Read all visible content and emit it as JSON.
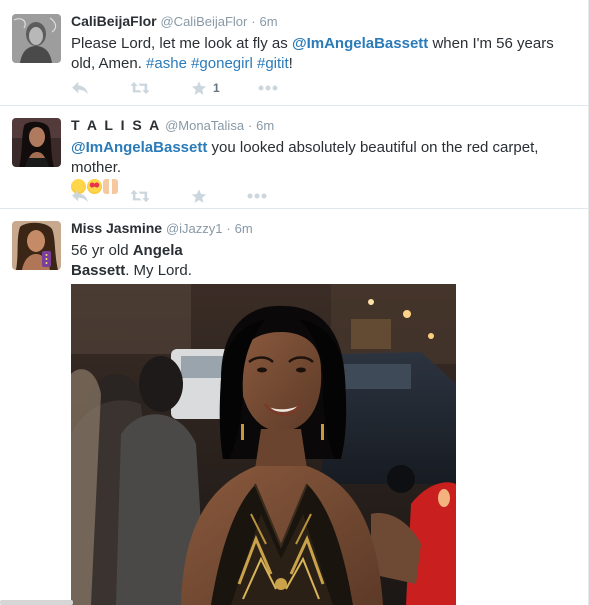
{
  "tweets": [
    {
      "fullname": "CaliBeijaFlor",
      "username": "@CaliBeijaFlor",
      "separator": "·",
      "time": "6m",
      "text_parts": {
        "p1": "Please Lord, let me look at fly as ",
        "mention": "@ImAngelaBassett",
        "p2": " when I'm 56 years old, Amen. ",
        "tag1": "#ashe",
        "tag2": "#gonegirl",
        "tag3": "#gitit",
        "p3": "!"
      },
      "favorite_count": "1"
    },
    {
      "fullname": "T A L I S A",
      "username": "@MonaTalisa",
      "separator": "·",
      "time": "6m",
      "text_parts": {
        "mention": "@ImAngelaBassett",
        "p1": " you looked absolutely beautiful on the red carpet, mother."
      },
      "emoji": [
        "weary-face-emoji",
        "heart-eyes-emoji",
        "raised-hands-emoji"
      ]
    },
    {
      "fullname": "Miss Jasmine",
      "username": "@iJazzy1",
      "separator": "·",
      "time": "6m",
      "text_parts": {
        "p1": "56 yr old ",
        "b1": "Angela",
        "b2": "Bassett",
        "p2": ". My Lord."
      }
    }
  ],
  "icons": [
    "reply-icon",
    "retweet-icon",
    "favorite-icon",
    "more-icon"
  ],
  "colors": {
    "link": "#2b7bb9",
    "muted": "#8899a6",
    "action_icon": "#ccd6dd",
    "text": "#292f33",
    "divider": "#e1e8ed"
  }
}
